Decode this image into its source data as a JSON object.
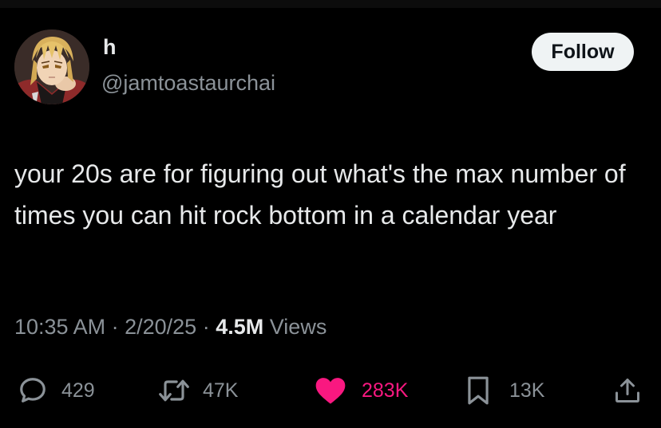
{
  "user": {
    "display_name": "h",
    "handle": "@jamtoastaurchai",
    "avatar_icon": "anime-character-avatar"
  },
  "follow_button": {
    "label": "Follow"
  },
  "tweet": {
    "text": "your 20s are for figuring out what's the max number of times you can hit rock bottom in a calendar year",
    "time": "10:35 AM",
    "separator": "·",
    "date": "2/20/25",
    "views_count": "4.5M",
    "views_label": "Views"
  },
  "actions": {
    "reply": {
      "icon": "reply-icon",
      "count": "429"
    },
    "repost": {
      "icon": "repost-icon",
      "count": "47K"
    },
    "like": {
      "icon": "heart-icon",
      "count": "283K",
      "active": true
    },
    "bookmark": {
      "icon": "bookmark-icon",
      "count": "13K"
    },
    "share": {
      "icon": "share-icon"
    }
  },
  "colors": {
    "background": "#000000",
    "text": "#e7e9ea",
    "secondary_text": "#8b9298",
    "like_pink": "#f91880",
    "follow_bg": "#eff3f4"
  }
}
